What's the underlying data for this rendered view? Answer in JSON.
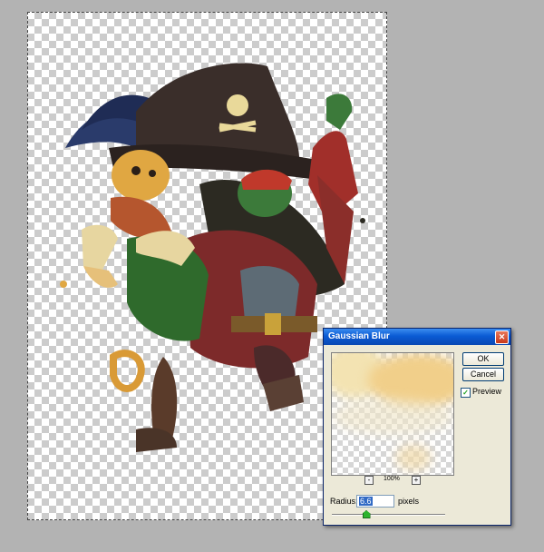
{
  "dialog": {
    "title": "Gaussian Blur",
    "ok_label": "OK",
    "cancel_label": "Cancel",
    "preview_label": "Preview",
    "preview_checked": true,
    "zoom_minus": "-",
    "zoom_level": "100%",
    "zoom_plus": "+",
    "radius_label": "Radius:",
    "radius_value": "6.6",
    "unit_label": "pixels",
    "slider_level_fraction": 0.3,
    "close_glyph": "✕"
  },
  "colors": {
    "titlebar": "#0a5bd4",
    "dialog_bg": "#ece9d8",
    "slider_thumb": "#2cb32c"
  },
  "icons": {
    "close": "close-icon",
    "check": "checkmark-icon"
  }
}
